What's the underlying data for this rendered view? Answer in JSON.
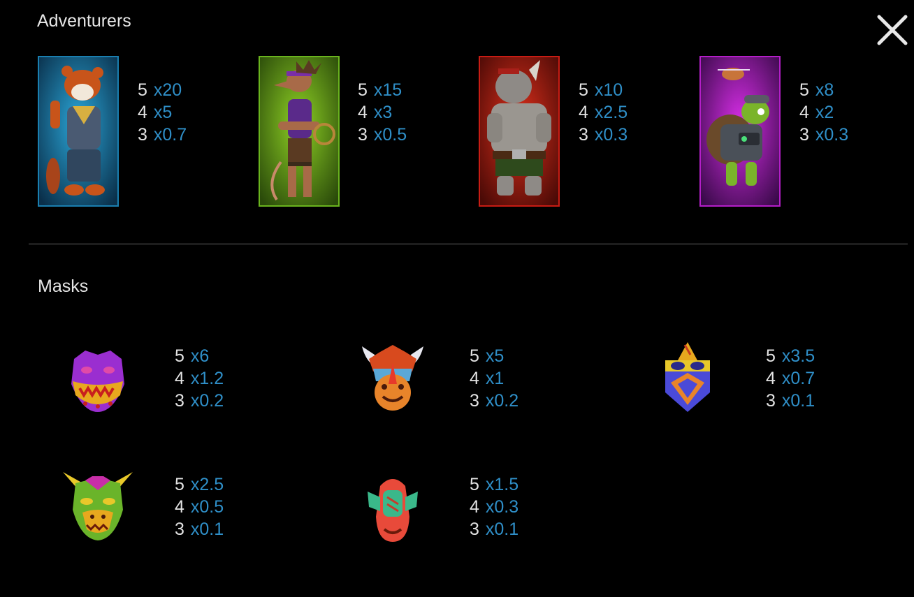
{
  "sections": {
    "adventurers_title": "Adventurers",
    "masks_title": "Masks"
  },
  "close_icon": "close-icon",
  "colors": {
    "background": "#000000",
    "count_text": "#e3e3e3",
    "multiplier_text": "#2f8fc8"
  },
  "adventurers": [
    {
      "character": "red-panda",
      "card_color": "#1a7fb0",
      "pays": [
        {
          "count": "5",
          "multiplier": "x20"
        },
        {
          "count": "4",
          "multiplier": "x5"
        },
        {
          "count": "3",
          "multiplier": "x0.7"
        }
      ]
    },
    {
      "character": "rat",
      "card_color": "#6ab41e",
      "pays": [
        {
          "count": "5",
          "multiplier": "x15"
        },
        {
          "count": "4",
          "multiplier": "x3"
        },
        {
          "count": "3",
          "multiplier": "x0.5"
        }
      ]
    },
    {
      "character": "rhino",
      "card_color": "#c81c14",
      "pays": [
        {
          "count": "5",
          "multiplier": "x10"
        },
        {
          "count": "4",
          "multiplier": "x2.5"
        },
        {
          "count": "3",
          "multiplier": "x0.3"
        }
      ]
    },
    {
      "character": "turtle",
      "card_color": "#b41ec8",
      "pays": [
        {
          "count": "5",
          "multiplier": "x8"
        },
        {
          "count": "4",
          "multiplier": "x2"
        },
        {
          "count": "3",
          "multiplier": "x0.3"
        }
      ]
    }
  ],
  "masks": [
    {
      "mask": "purple-dragon-mask",
      "pays": [
        {
          "count": "5",
          "multiplier": "x6"
        },
        {
          "count": "4",
          "multiplier": "x1.2"
        },
        {
          "count": "3",
          "multiplier": "x0.2"
        }
      ]
    },
    {
      "mask": "horned-orange-mask",
      "pays": [
        {
          "count": "5",
          "multiplier": "x5"
        },
        {
          "count": "4",
          "multiplier": "x1"
        },
        {
          "count": "3",
          "multiplier": "x0.2"
        }
      ]
    },
    {
      "mask": "blue-gold-mask",
      "pays": [
        {
          "count": "5",
          "multiplier": "x3.5"
        },
        {
          "count": "4",
          "multiplier": "x0.7"
        },
        {
          "count": "3",
          "multiplier": "x0.1"
        }
      ]
    },
    {
      "mask": "green-horned-mask",
      "pays": [
        {
          "count": "5",
          "multiplier": "x2.5"
        },
        {
          "count": "4",
          "multiplier": "x0.5"
        },
        {
          "count": "3",
          "multiplier": "x0.1"
        }
      ]
    },
    {
      "mask": "red-long-mask",
      "pays": [
        {
          "count": "5",
          "multiplier": "x1.5"
        },
        {
          "count": "4",
          "multiplier": "x0.3"
        },
        {
          "count": "3",
          "multiplier": "x0.1"
        }
      ]
    }
  ]
}
